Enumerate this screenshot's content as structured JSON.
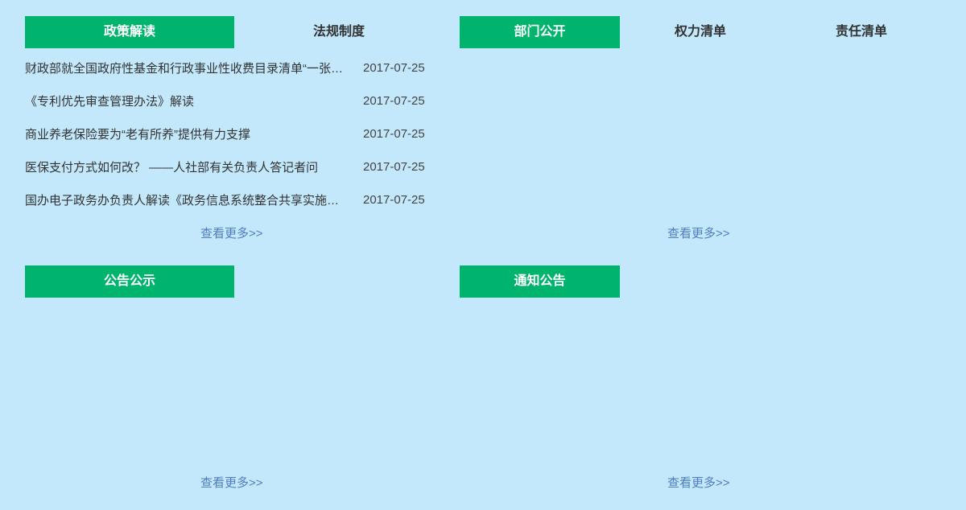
{
  "policy_panel": {
    "tabs": [
      {
        "label": "政策解读",
        "active": true
      },
      {
        "label": "法规制度",
        "active": false
      }
    ],
    "items": [
      {
        "title": "财政部就全国政府性基金和行政事业性收费目录清单“一张网”答记者问",
        "date": "2017-07-25"
      },
      {
        "title": "《专利优先审查管理办法》解读",
        "date": "2017-07-25"
      },
      {
        "title": "商业养老保险要为“老有所养”提供有力支撑",
        "date": "2017-07-25"
      },
      {
        "title": "医保支付方式如何改？ ——人社部有关负责人答记者问",
        "date": "2017-07-25"
      },
      {
        "title": "国办电子政务办负责人解读《政务信息系统整合共享实施方案》",
        "date": "2017-07-25"
      }
    ],
    "more": "查看更多>>"
  },
  "department_panel": {
    "tabs": [
      {
        "label": "部门公开",
        "active": true
      },
      {
        "label": "权力清单",
        "active": false
      },
      {
        "label": "责任清单",
        "active": false
      }
    ],
    "more": "查看更多>>"
  },
  "announcement_panel": {
    "tabs": [
      {
        "label": "公告公示",
        "active": true
      }
    ],
    "more": "查看更多>>"
  },
  "notice_panel": {
    "tabs": [
      {
        "label": "通知公告",
        "active": true
      }
    ],
    "more": "查看更多>>"
  },
  "colors": {
    "background": "#c3e8fc",
    "active_tab": "#00b46e",
    "more_link": "#4f7ec0"
  }
}
